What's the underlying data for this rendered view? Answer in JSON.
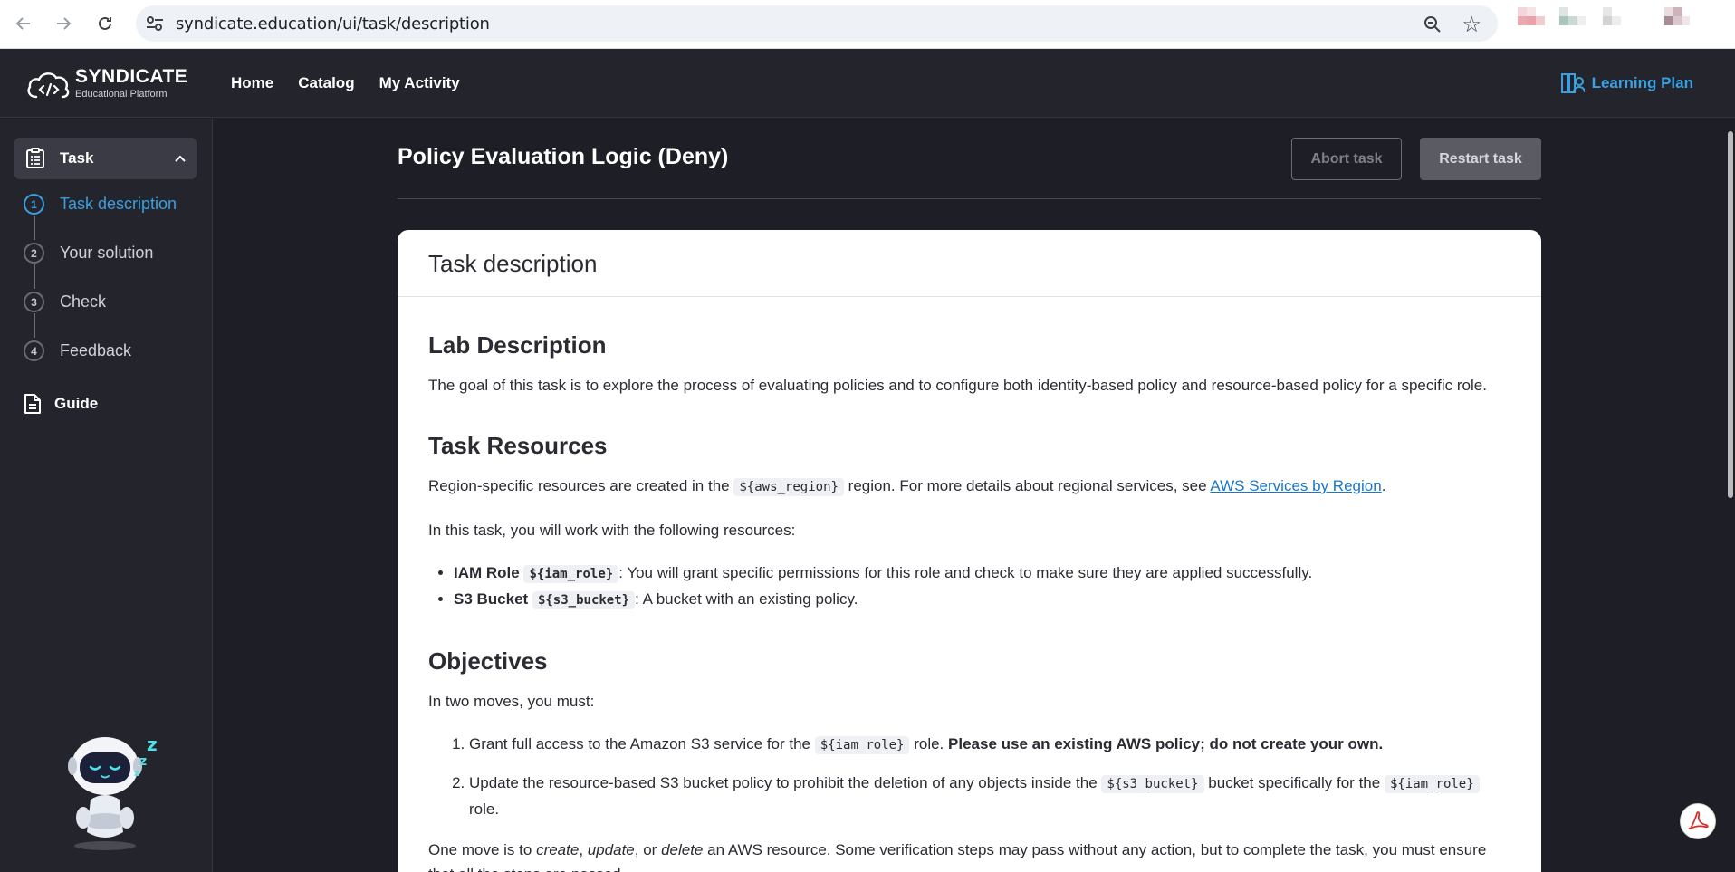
{
  "browser": {
    "url": "syndicate.education/ui/task/description"
  },
  "header": {
    "brand_name": "SYNDICATE",
    "brand_sub": "Educational Platform",
    "nav": [
      "Home",
      "Catalog",
      "My Activity"
    ],
    "learning_plan": "Learning Plan",
    "accent_color": "#3aa0e0"
  },
  "sidebar": {
    "task_label": "Task",
    "steps": [
      {
        "num": "1",
        "label": "Task description"
      },
      {
        "num": "2",
        "label": "Your solution"
      },
      {
        "num": "3",
        "label": "Check"
      },
      {
        "num": "4",
        "label": "Feedback"
      }
    ],
    "guide_label": "Guide"
  },
  "main": {
    "title": "Policy Evaluation Logic (Deny)",
    "abort_label": "Abort task",
    "restart_label": "Restart task",
    "card_title": "Task description",
    "lab_heading": "Lab Description",
    "lab_text": "The goal of this task is to explore the process of evaluating policies and to configure both identity-based policy and resource-based policy for a specific role.",
    "resources_heading": "Task Resources",
    "region_pre": "Region-specific resources are created in the",
    "region_code": "${aws_region}",
    "region_post": "region. For more details about regional services, see",
    "region_link": "AWS Services by Region",
    "resources_intro": "In this task, you will work with the following resources:",
    "resources": [
      {
        "name": "IAM Role",
        "code": "${iam_role}",
        "desc": ": You will grant specific permissions for this role and check to make sure they are applied successfully."
      },
      {
        "name": "S3 Bucket",
        "code": "${s3_bucket}",
        "desc": ": A bucket with an existing policy."
      }
    ],
    "objectives_heading": "Objectives",
    "objectives_intro": "In two moves, you must:",
    "obj1_pre": "Grant full access to the Amazon S3 service for the",
    "obj1_code": "${iam_role}",
    "obj1_mid": "role.",
    "obj1_bold": "Please use an existing AWS policy; do not create your own.",
    "obj2_pre": "Update the resource-based S3 bucket policy to prohibit the deletion of any objects inside the",
    "obj2_code1": "${s3_bucket}",
    "obj2_mid": "bucket specifically for the",
    "obj2_code2": "${iam_role}",
    "obj2_post": "role.",
    "moves_pre": "One move is to",
    "moves_create": "create",
    "moves_update": "update",
    "moves_or": ", or",
    "moves_delete": "delete",
    "moves_post": "an AWS resource. Some verification steps may pass without any action, but to complete the task, you must ensure that all the steps are passed."
  }
}
